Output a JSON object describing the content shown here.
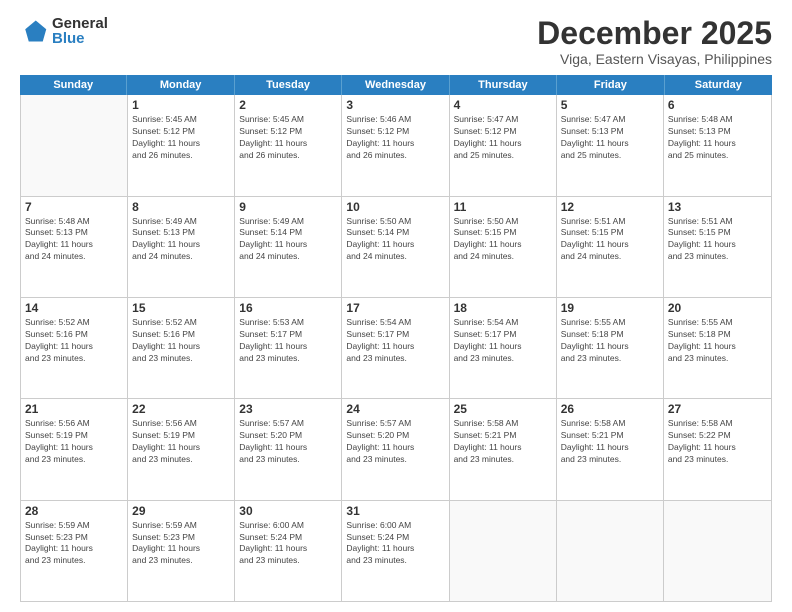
{
  "logo": {
    "general": "General",
    "blue": "Blue"
  },
  "title": "December 2025",
  "subtitle": "Viga, Eastern Visayas, Philippines",
  "days": [
    "Sunday",
    "Monday",
    "Tuesday",
    "Wednesday",
    "Thursday",
    "Friday",
    "Saturday"
  ],
  "weeks": [
    [
      {
        "day": "",
        "info": ""
      },
      {
        "day": "1",
        "info": "Sunrise: 5:45 AM\nSunset: 5:12 PM\nDaylight: 11 hours\nand 26 minutes."
      },
      {
        "day": "2",
        "info": "Sunrise: 5:45 AM\nSunset: 5:12 PM\nDaylight: 11 hours\nand 26 minutes."
      },
      {
        "day": "3",
        "info": "Sunrise: 5:46 AM\nSunset: 5:12 PM\nDaylight: 11 hours\nand 26 minutes."
      },
      {
        "day": "4",
        "info": "Sunrise: 5:47 AM\nSunset: 5:12 PM\nDaylight: 11 hours\nand 25 minutes."
      },
      {
        "day": "5",
        "info": "Sunrise: 5:47 AM\nSunset: 5:13 PM\nDaylight: 11 hours\nand 25 minutes."
      },
      {
        "day": "6",
        "info": "Sunrise: 5:48 AM\nSunset: 5:13 PM\nDaylight: 11 hours\nand 25 minutes."
      }
    ],
    [
      {
        "day": "7",
        "info": "Sunrise: 5:48 AM\nSunset: 5:13 PM\nDaylight: 11 hours\nand 24 minutes."
      },
      {
        "day": "8",
        "info": "Sunrise: 5:49 AM\nSunset: 5:13 PM\nDaylight: 11 hours\nand 24 minutes."
      },
      {
        "day": "9",
        "info": "Sunrise: 5:49 AM\nSunset: 5:14 PM\nDaylight: 11 hours\nand 24 minutes."
      },
      {
        "day": "10",
        "info": "Sunrise: 5:50 AM\nSunset: 5:14 PM\nDaylight: 11 hours\nand 24 minutes."
      },
      {
        "day": "11",
        "info": "Sunrise: 5:50 AM\nSunset: 5:15 PM\nDaylight: 11 hours\nand 24 minutes."
      },
      {
        "day": "12",
        "info": "Sunrise: 5:51 AM\nSunset: 5:15 PM\nDaylight: 11 hours\nand 24 minutes."
      },
      {
        "day": "13",
        "info": "Sunrise: 5:51 AM\nSunset: 5:15 PM\nDaylight: 11 hours\nand 23 minutes."
      }
    ],
    [
      {
        "day": "14",
        "info": "Sunrise: 5:52 AM\nSunset: 5:16 PM\nDaylight: 11 hours\nand 23 minutes."
      },
      {
        "day": "15",
        "info": "Sunrise: 5:52 AM\nSunset: 5:16 PM\nDaylight: 11 hours\nand 23 minutes."
      },
      {
        "day": "16",
        "info": "Sunrise: 5:53 AM\nSunset: 5:17 PM\nDaylight: 11 hours\nand 23 minutes."
      },
      {
        "day": "17",
        "info": "Sunrise: 5:54 AM\nSunset: 5:17 PM\nDaylight: 11 hours\nand 23 minutes."
      },
      {
        "day": "18",
        "info": "Sunrise: 5:54 AM\nSunset: 5:17 PM\nDaylight: 11 hours\nand 23 minutes."
      },
      {
        "day": "19",
        "info": "Sunrise: 5:55 AM\nSunset: 5:18 PM\nDaylight: 11 hours\nand 23 minutes."
      },
      {
        "day": "20",
        "info": "Sunrise: 5:55 AM\nSunset: 5:18 PM\nDaylight: 11 hours\nand 23 minutes."
      }
    ],
    [
      {
        "day": "21",
        "info": "Sunrise: 5:56 AM\nSunset: 5:19 PM\nDaylight: 11 hours\nand 23 minutes."
      },
      {
        "day": "22",
        "info": "Sunrise: 5:56 AM\nSunset: 5:19 PM\nDaylight: 11 hours\nand 23 minutes."
      },
      {
        "day": "23",
        "info": "Sunrise: 5:57 AM\nSunset: 5:20 PM\nDaylight: 11 hours\nand 23 minutes."
      },
      {
        "day": "24",
        "info": "Sunrise: 5:57 AM\nSunset: 5:20 PM\nDaylight: 11 hours\nand 23 minutes."
      },
      {
        "day": "25",
        "info": "Sunrise: 5:58 AM\nSunset: 5:21 PM\nDaylight: 11 hours\nand 23 minutes."
      },
      {
        "day": "26",
        "info": "Sunrise: 5:58 AM\nSunset: 5:21 PM\nDaylight: 11 hours\nand 23 minutes."
      },
      {
        "day": "27",
        "info": "Sunrise: 5:58 AM\nSunset: 5:22 PM\nDaylight: 11 hours\nand 23 minutes."
      }
    ],
    [
      {
        "day": "28",
        "info": "Sunrise: 5:59 AM\nSunset: 5:23 PM\nDaylight: 11 hours\nand 23 minutes."
      },
      {
        "day": "29",
        "info": "Sunrise: 5:59 AM\nSunset: 5:23 PM\nDaylight: 11 hours\nand 23 minutes."
      },
      {
        "day": "30",
        "info": "Sunrise: 6:00 AM\nSunset: 5:24 PM\nDaylight: 11 hours\nand 23 minutes."
      },
      {
        "day": "31",
        "info": "Sunrise: 6:00 AM\nSunset: 5:24 PM\nDaylight: 11 hours\nand 23 minutes."
      },
      {
        "day": "",
        "info": ""
      },
      {
        "day": "",
        "info": ""
      },
      {
        "day": "",
        "info": ""
      }
    ]
  ]
}
